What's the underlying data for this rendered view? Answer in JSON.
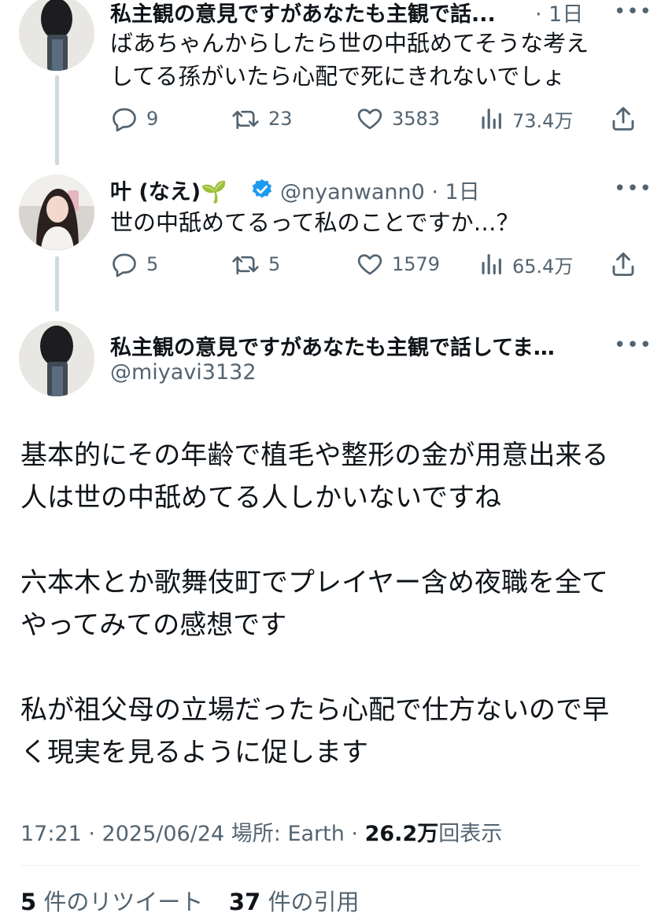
{
  "tweet1": {
    "name": "私主観の意見ですがあなたも主観で話...",
    "time": "· 1日",
    "text": "ばあちゃんからしたら世の中舐めてそうな考え\nしてる孫がいたら心配で死にきれないでしょ",
    "replies": "9",
    "retweets": "23",
    "likes": "3583",
    "views": "73.4万"
  },
  "tweet2": {
    "name": "叶 (なえ)",
    "name_emoji": "🌱",
    "handle": "@nyanwann0",
    "time": "· 1日",
    "text": "世の中舐めてるって私のことですか…？",
    "replies": "5",
    "retweets": "5",
    "likes": "1579",
    "views": "65.4万"
  },
  "main": {
    "name": "私主観の意見ですがあなたも主観で話してま…",
    "handle": "@miyavi3132",
    "text": "基本的にその年齢で植毛や整形の金が用意出来る\n人は世の中舐めてる人しかいないですね\n\n六本木とか歌舞伎町でプレイヤー含め夜職を全て\nやってみての感想です\n\n私が祖父母の立場だったら心配で仕方ないので早\nく現実を見るように促します",
    "timestamp": "17:21 · 2025/06/24 場所: Earth ·",
    "views_count": "26.2万",
    "views_label": "回表示"
  },
  "stats": {
    "retweets_count": "5",
    "retweets_label": "件のリツイート",
    "quotes_count": "37",
    "quotes_label": "件の引用"
  },
  "more_label": "•••",
  "colors": {
    "verified": "#1d9bf0",
    "text": "#0f1419",
    "muted": "#536471",
    "line": "#cfd9de"
  },
  "icons": [
    "reply-icon",
    "retweet-icon",
    "like-icon",
    "views-icon",
    "share-icon",
    "verified-icon",
    "more-icon"
  ]
}
